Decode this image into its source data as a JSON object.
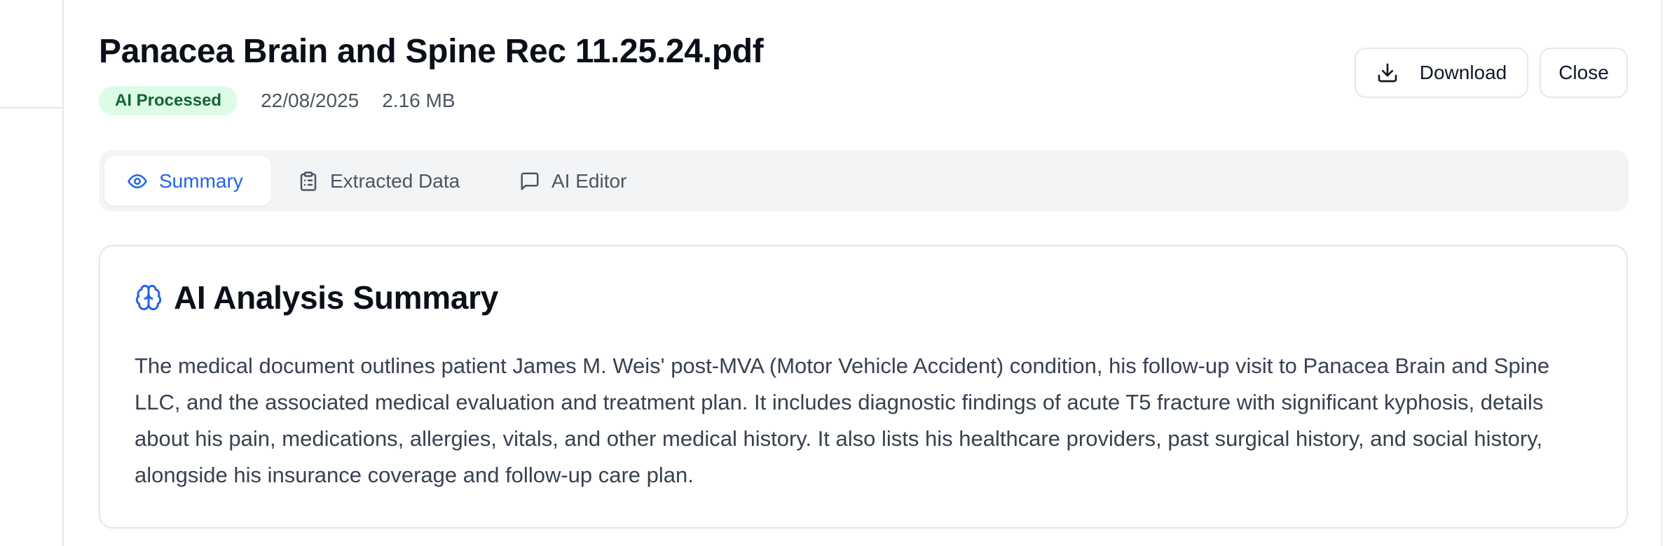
{
  "document": {
    "title": "Panacea Brain and Spine Rec 11.25.24.pdf",
    "status_badge": "AI Processed",
    "date": "22/08/2025",
    "size": "2.16 MB"
  },
  "actions": {
    "download_label": "Download",
    "download_icon": "download-icon",
    "close_label": "Close"
  },
  "tabs": [
    {
      "label": "Summary",
      "icon": "eye-icon",
      "active": true
    },
    {
      "label": "Extracted Data",
      "icon": "clipboard-icon",
      "active": false
    },
    {
      "label": "AI Editor",
      "icon": "chat-bubble-icon",
      "active": false
    }
  ],
  "summary_card": {
    "icon": "brain-icon",
    "title": "AI Analysis Summary",
    "body": "The medical document outlines patient James M. Weis' post-MVA (Motor Vehicle Accident) condition, his follow-up visit to Panacea Brain and Spine LLC, and the associated medical evaluation and treatment plan. It includes diagnostic findings of acute T5 fracture with significant kyphosis, details about his pain, medications, allergies, vitals, and other medical history. It also lists his healthcare providers, past surgical history, and social history, alongside his insurance coverage and follow-up care plan."
  },
  "colors": {
    "accent": "#2563eb",
    "badge_bg": "#dcfce7",
    "badge_text": "#166534",
    "tab_bar_bg": "#f3f4f6",
    "border": "#e5e7eb"
  }
}
